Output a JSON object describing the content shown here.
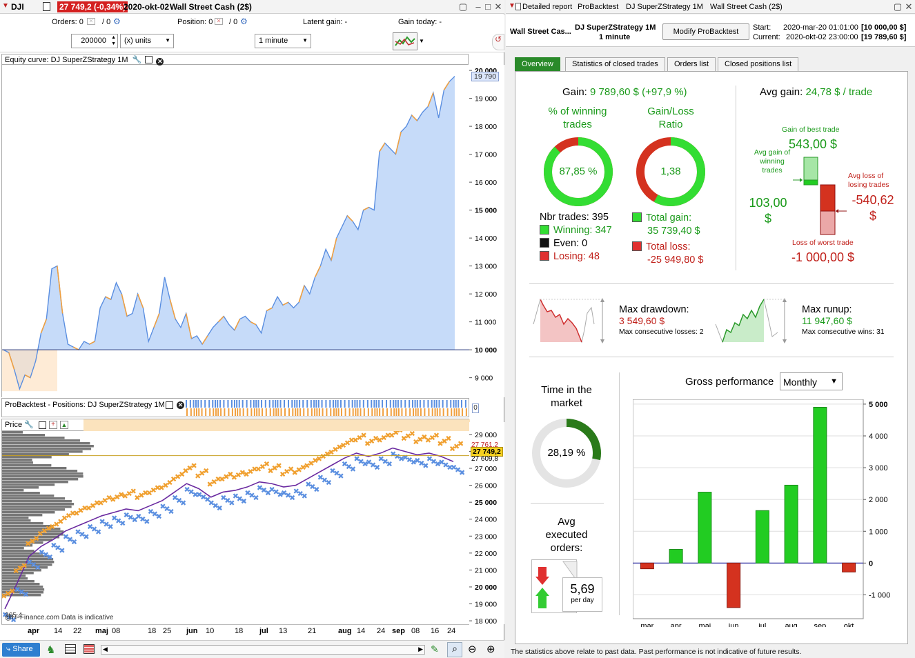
{
  "left": {
    "title": {
      "symbol": "DJI",
      "price_badge": "27 749,2 (-0,34%)",
      "date": "2020-okt-02",
      "instrument": "Wall Street Cash (2$)"
    },
    "info_row": {
      "orders_label": "Orders: 0",
      "orders_extra": "/ 0",
      "position_label": "Position: 0",
      "position_extra": "/ 0",
      "latent_gain": "Latent gain: -",
      "gain_today": "Gain today: -"
    },
    "controls": {
      "quantity": "200000",
      "units": "(x) units",
      "timeframe": "1 minute"
    },
    "equity_panel": {
      "title": "Equity curve: DJ SuperZStrategy 1M",
      "y_ticks": [
        "20 000",
        "19 000",
        "18 000",
        "17 000",
        "16 000",
        "15 000",
        "14 000",
        "13 000",
        "12 000",
        "11 000",
        "10 000",
        "9 000"
      ],
      "last_value": "19 790"
    },
    "positions_panel": {
      "title": "ProBacktest - Positions: DJ SuperZStrategy 1M",
      "value": "0"
    },
    "price_panel": {
      "title": "Price",
      "y_ticks": [
        "29 000",
        "28 000",
        "27 000",
        "26 000",
        "25 000",
        "24 000",
        "23 000",
        "22 000",
        "21 000",
        "20 000",
        "19 000",
        "18 000"
      ],
      "price_badge": "27 749,2",
      "price_under": "27 609,8",
      "price_above": "27 761,2",
      "source": "@IT-Finance.com  Data is indicative",
      "bottom_left": "365,4"
    },
    "x_axis": {
      "labels": [
        "apr",
        "14",
        "22",
        "maj",
        "08",
        "18",
        "25",
        "jun",
        "10",
        "18",
        "jul",
        "13",
        "21",
        "aug",
        "14",
        "24",
        "sep",
        "08",
        "16",
        "24",
        "okt"
      ]
    },
    "bottom_bar": {
      "share": "Share"
    }
  },
  "right": {
    "title_tabs": [
      "Detailed report",
      "ProBacktest",
      "DJ SuperZStrategy 1M",
      "Wall Street Cash (2$)"
    ],
    "header": {
      "instrument": "Wall Street Cas...",
      "strategy": "DJ SuperZStrategy 1M",
      "timeframe": "1 minute",
      "modify_button": "Modify ProBacktest",
      "start_label": "Start:",
      "start_value": "2020-mar-20 01:01:00",
      "start_capital": "[10 000,00 $]",
      "current_label": "Current:",
      "current_value": "2020-okt-02 23:00:00",
      "current_capital": "[19 789,60 $]"
    },
    "tabs": [
      "Overview",
      "Statistics of closed trades",
      "Orders list",
      "Closed positions list"
    ],
    "overview": {
      "gain_label": "Gain:",
      "gain_value": "9 789,60 $ (+97,9 %)",
      "winning_pct_title_1": "% of winning",
      "winning_pct_title_2": "trades",
      "winning_pct": "87,85 %",
      "winning_pct_fraction": 0.8785,
      "gl_ratio_title_1": "Gain/Loss",
      "gl_ratio_title_2": "Ratio",
      "gl_ratio": "1,38",
      "gl_ratio_fraction": 0.58,
      "nbr_trades": "Nbr trades: 395",
      "winning": "Winning: 347",
      "even": "Even: 0",
      "losing": "Losing: 48",
      "total_gain_label": "Total gain:",
      "total_gain": "35 739,40 $",
      "total_loss_label": "Total loss:",
      "total_loss": "-25 949,80 $",
      "avg_gain_label": "Avg gain:",
      "avg_gain": "24,78 $ / trade",
      "best_trade_label": "Gain of best trade",
      "best_trade": "543,00 $",
      "avg_gain_winning_label_1": "Avg gain of",
      "avg_gain_winning_label_2": "winning",
      "avg_gain_winning_label_3": "trades",
      "avg_gain_winning_1": "103,00",
      "avg_gain_winning_2": "$",
      "avg_loss_losing_label_1": "Avg loss of",
      "avg_loss_losing_label_2": "losing trades",
      "avg_loss_losing_1": "-540,62",
      "avg_loss_losing_2": "$",
      "worst_trade_label": "Loss of worst trade",
      "worst_trade": "-1 000,00 $",
      "max_drawdown_label": "Max drawdown:",
      "max_drawdown": "3 549,60 $",
      "max_consec_losses": "Max consecutive losses: 2",
      "max_runup_label": "Max runup:",
      "max_runup": "11 947,60 $",
      "max_consec_wins": "Max consecutive wins: 31",
      "time_market_label_1": "Time in the",
      "time_market_label_2": "market",
      "time_market": "28,19 %",
      "time_market_fraction": 0.2819,
      "avg_orders_label_1": "Avg",
      "avg_orders_label_2": "executed",
      "avg_orders_label_3": "orders:",
      "avg_orders": "5,69",
      "avg_orders_unit": "per day",
      "gross_perf_label": "Gross performance",
      "gross_perf_period": "Monthly"
    },
    "disclaimer": "The statistics above relate to past data. Past performance is not indicative of future results."
  },
  "chart_data": [
    {
      "type": "bar",
      "title": "Gross performance",
      "categories": [
        "mar",
        "apr",
        "maj",
        "jun",
        "jul",
        "aug",
        "sep",
        "okt"
      ],
      "values": [
        -180,
        430,
        2230,
        -1400,
        1650,
        2450,
        4900,
        -280
      ],
      "ylim": [
        -1750,
        5150
      ],
      "y_ticks": [
        5000,
        4000,
        3000,
        2000,
        1000,
        0,
        -1000
      ],
      "y_tick_labels": [
        "5 000",
        "4 000",
        "3 000",
        "2 000",
        "1 000",
        "0",
        "-1 000"
      ],
      "positive_color": "#22cc22",
      "negative_color": "#d4321f"
    },
    {
      "type": "area",
      "title": "Equity curve: DJ SuperZStrategy 1M",
      "x_labels": [
        "apr",
        "maj",
        "jun",
        "jul",
        "aug",
        "sep",
        "okt"
      ],
      "ylim": [
        8300,
        20200
      ],
      "baseline": 10000,
      "values": [
        10000,
        9900,
        9300,
        8600,
        9100,
        9000,
        9600,
        10600,
        11100,
        12900,
        13000,
        11300,
        10200,
        10100,
        10000,
        10300,
        10200,
        10300,
        11500,
        11900,
        11800,
        12400,
        12000,
        11200,
        11300,
        12000,
        11500,
        10300,
        10800,
        11300,
        12600,
        11800,
        11100,
        10800,
        11300,
        10400,
        10500,
        10200,
        10500,
        10800,
        11000,
        11200,
        10900,
        10700,
        11100,
        11200,
        11000,
        10900,
        10600,
        11400,
        11500,
        11900,
        11600,
        11700,
        11500,
        11700,
        12300,
        12000,
        12600,
        13000,
        13600,
        13200,
        14000,
        14400,
        14800,
        14600,
        14300,
        15000,
        15100,
        15000,
        17100,
        17400,
        17200,
        17000,
        17800,
        18000,
        18400,
        18200,
        18500,
        18700,
        19200,
        18300,
        19300,
        19600,
        19790
      ]
    }
  ]
}
